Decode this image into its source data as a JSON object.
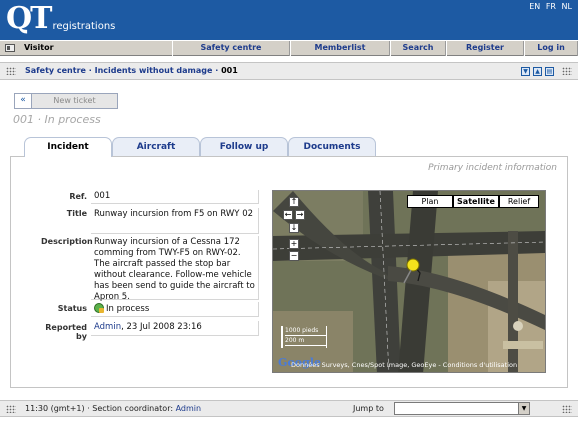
{
  "header": {
    "logo_mark": "QT",
    "logo_text": "registrations",
    "languages": [
      "EN",
      "FR",
      "NL"
    ]
  },
  "nav": {
    "visitor_label": "Visitor",
    "items": [
      "Safety centre",
      "Memberlist",
      "Search",
      "Register",
      "Log in"
    ]
  },
  "breadcrumb": {
    "section": "Safety centre",
    "sep": "·",
    "page": "Incidents without damage",
    "current": "001"
  },
  "toolbar": {
    "back_label": "«",
    "new_ticket_label": "New ticket"
  },
  "ticket": {
    "title": "001 · In process"
  },
  "tabs": [
    {
      "label": "Incident",
      "active": true
    },
    {
      "label": "Aircraft",
      "active": false
    },
    {
      "label": "Follow up",
      "active": false
    },
    {
      "label": "Documents",
      "active": false
    }
  ],
  "panel": {
    "heading": "Primary incident information",
    "fields": {
      "ref_label": "Ref.",
      "ref_value": "001",
      "title_label": "Title",
      "title_value": "Runway incursion from F5 on RWY 02",
      "description_label": "Description",
      "description_value": "Runway incursion of a Cessna 172 comming from TWY-F5 on RWY-02. The aircraft passed the stop bar without clearance. Follow-me vehicle has been send to guide the aircraft to Apron 5.",
      "status_label": "Status",
      "status_value": "In process",
      "reported_label": "Reported by",
      "reported_user": "Admin",
      "reported_date": ", 23 Jul 2008 23:16"
    }
  },
  "map": {
    "modes": [
      "Plan",
      "Satellite",
      "Relief"
    ],
    "selected_mode": "Satellite",
    "scale_ft": "1000 pieds",
    "scale_m": "200 m",
    "google_label": "Google",
    "copyright": "Données Surveys, Cnes/Spot Image, GeoEye - Conditions d'utilisation"
  },
  "footer": {
    "time": "11:30 (gmt+1)",
    "sep": "·",
    "coordinator_label": "Section coordinator:",
    "coordinator_name": "Admin",
    "jump_label": "Jump to"
  },
  "colors": {
    "header_bg": "#1d5aa3",
    "link": "#1d3b8c",
    "nav_bg": "#d4d0c8"
  }
}
